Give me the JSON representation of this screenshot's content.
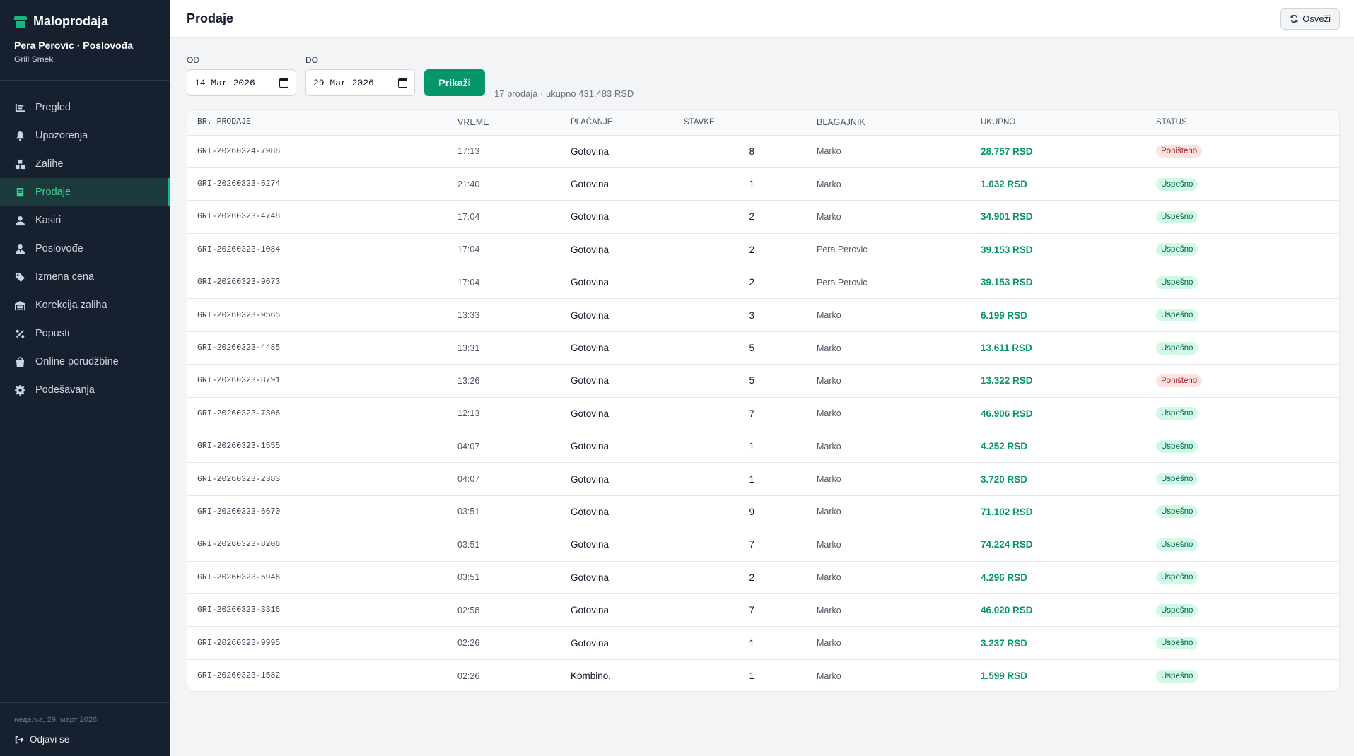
{
  "app": {
    "brand": "Maloprodaja",
    "user_line": "Pera Perovic · Poslovođa",
    "store": "Grill Smek"
  },
  "nav": [
    {
      "label": "Pregled",
      "icon": "chart-list-icon",
      "active": false
    },
    {
      "label": "Upozorenja",
      "icon": "bell-icon",
      "active": false
    },
    {
      "label": "Zalihe",
      "icon": "boxes-icon",
      "active": false
    },
    {
      "label": "Prodaje",
      "icon": "receipt-icon",
      "active": true
    },
    {
      "label": "Kasiri",
      "icon": "user-icon",
      "active": false
    },
    {
      "label": "Poslovođe",
      "icon": "user-tie-icon",
      "active": false
    },
    {
      "label": "Izmena cena",
      "icon": "tag-icon",
      "active": false
    },
    {
      "label": "Korekcija zaliha",
      "icon": "warehouse-icon",
      "active": false
    },
    {
      "label": "Popusti",
      "icon": "percent-icon",
      "active": false
    },
    {
      "label": "Online porudžbine",
      "icon": "shopping-bag-icon",
      "active": false
    },
    {
      "label": "Podešavanja",
      "icon": "gear-icon",
      "active": false
    }
  ],
  "footer": {
    "date": "недеља, 29. март 2026.",
    "logout": "Odjavi se"
  },
  "header": {
    "title": "Prodaje",
    "refresh_label": "Osveži"
  },
  "filters": {
    "from_label": "OD",
    "from_value": "14-Mar-2026",
    "to_label": "DO",
    "to_value": "29-Mar-2026",
    "show_label": "Prikaži",
    "summary": "17 prodaja · ukupno 431.483 RSD"
  },
  "table": {
    "columns": [
      "BR. PRODAJE",
      "VREME",
      "PLAĆANJE",
      "STAVKE",
      "BLAGAJNIK",
      "UKUPNO",
      "STATUS"
    ],
    "rows": [
      {
        "id": "GRI-20260324-7988",
        "time": "17:13",
        "payment": "Gotovina",
        "items": "8",
        "cashier": "Marko",
        "total": "28.757 RSD",
        "status": "Poništeno",
        "status_kind": "void"
      },
      {
        "id": "GRI-20260323-6274",
        "time": "21:40",
        "payment": "Gotovina",
        "items": "1",
        "cashier": "Marko",
        "total": "1.032 RSD",
        "status": "Uspešno",
        "status_kind": "ok"
      },
      {
        "id": "GRI-20260323-4748",
        "time": "17:04",
        "payment": "Gotovina",
        "items": "2",
        "cashier": "Marko",
        "total": "34.901 RSD",
        "status": "Uspešno",
        "status_kind": "ok"
      },
      {
        "id": "GRI-20260323-1084",
        "time": "17:04",
        "payment": "Gotovina",
        "items": "2",
        "cashier": "Pera Perovic",
        "total": "39.153 RSD",
        "status": "Uspešno",
        "status_kind": "ok"
      },
      {
        "id": "GRI-20260323-9673",
        "time": "17:04",
        "payment": "Gotovina",
        "items": "2",
        "cashier": "Pera Perovic",
        "total": "39.153 RSD",
        "status": "Uspešno",
        "status_kind": "ok"
      },
      {
        "id": "GRI-20260323-9565",
        "time": "13:33",
        "payment": "Gotovina",
        "items": "3",
        "cashier": "Marko",
        "total": "6.199 RSD",
        "status": "Uspešno",
        "status_kind": "ok"
      },
      {
        "id": "GRI-20260323-4485",
        "time": "13:31",
        "payment": "Gotovina",
        "items": "5",
        "cashier": "Marko",
        "total": "13.611 RSD",
        "status": "Uspešno",
        "status_kind": "ok"
      },
      {
        "id": "GRI-20260323-8791",
        "time": "13:26",
        "payment": "Gotovina",
        "items": "5",
        "cashier": "Marko",
        "total": "13.322 RSD",
        "status": "Poništeno",
        "status_kind": "void"
      },
      {
        "id": "GRI-20260323-7306",
        "time": "12:13",
        "payment": "Gotovina",
        "items": "7",
        "cashier": "Marko",
        "total": "46.906 RSD",
        "status": "Uspešno",
        "status_kind": "ok"
      },
      {
        "id": "GRI-20260323-1555",
        "time": "04:07",
        "payment": "Gotovina",
        "items": "1",
        "cashier": "Marko",
        "total": "4.252 RSD",
        "status": "Uspešno",
        "status_kind": "ok"
      },
      {
        "id": "GRI-20260323-2383",
        "time": "04:07",
        "payment": "Gotovina",
        "items": "1",
        "cashier": "Marko",
        "total": "3.720 RSD",
        "status": "Uspešno",
        "status_kind": "ok"
      },
      {
        "id": "GRI-20260323-6670",
        "time": "03:51",
        "payment": "Gotovina",
        "items": "9",
        "cashier": "Marko",
        "total": "71.102 RSD",
        "status": "Uspešno",
        "status_kind": "ok"
      },
      {
        "id": "GRI-20260323-8206",
        "time": "03:51",
        "payment": "Gotovina",
        "items": "7",
        "cashier": "Marko",
        "total": "74.224 RSD",
        "status": "Uspešno",
        "status_kind": "ok"
      },
      {
        "id": "GRI-20260323-5946",
        "time": "03:51",
        "payment": "Gotovina",
        "items": "2",
        "cashier": "Marko",
        "total": "4.296 RSD",
        "status": "Uspešno",
        "status_kind": "ok"
      },
      {
        "id": "GRI-20260323-3316",
        "time": "02:58",
        "payment": "Gotovina",
        "items": "7",
        "cashier": "Marko",
        "total": "46.020 RSD",
        "status": "Uspešno",
        "status_kind": "ok"
      },
      {
        "id": "GRI-20260323-9995",
        "time": "02:26",
        "payment": "Gotovina",
        "items": "1",
        "cashier": "Marko",
        "total": "3.237 RSD",
        "status": "Uspešno",
        "status_kind": "ok"
      },
      {
        "id": "GRI-20260323-1582",
        "time": "02:26",
        "payment": "Kombino.",
        "items": "1",
        "cashier": "Marko",
        "total": "1.599 RSD",
        "status": "Uspešno",
        "status_kind": "ok"
      }
    ]
  },
  "colors": {
    "sidebar_bg": "#17202f",
    "accent": "#10b981",
    "total_green": "#059669",
    "ok_badge_bg": "#d1fae5",
    "void_badge_bg": "#fde2e2"
  }
}
